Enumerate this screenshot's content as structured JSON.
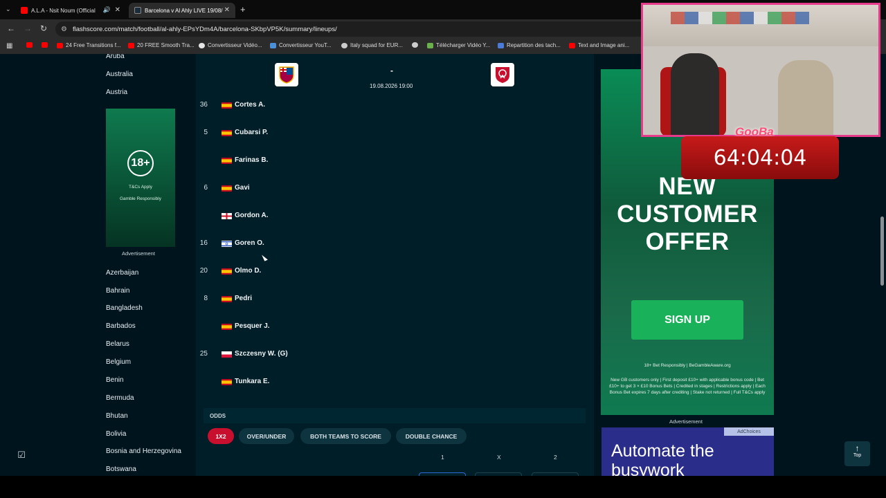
{
  "browser": {
    "tabs": [
      {
        "title": "A.L.A - Nsit Noum (Official",
        "favicon_color": "#ff0000"
      },
      {
        "title": "Barcelona v Al Ahly LIVE 19/08/",
        "favicon_color": "#1b2d3a"
      }
    ],
    "url": "flashscore.com/match/football/al-ahly-EPsYDm4A/barcelona-SKbpVP5K/summary/lineups/",
    "bookmarks": [
      {
        "label": "",
        "color": "#ff0000"
      },
      {
        "label": "",
        "color": "#ff0000"
      },
      {
        "label": "24 Free Transitions f...",
        "color": "#ff0000"
      },
      {
        "label": "20 FREE Smooth Tra...",
        "color": "#ff0000"
      },
      {
        "label": "Convertisseur Vidéo...",
        "color": "#e6e6e6"
      },
      {
        "label": "Convertisseur YouT...",
        "color": "#4a90d9"
      },
      {
        "label": "Italy squad for EUR...",
        "color": "#cccccc"
      },
      {
        "label": "",
        "color": "#cccccc"
      },
      {
        "label": "Télécharger Vidéo Y...",
        "color": "#6ab04c"
      },
      {
        "label": "Repartition des tach...",
        "color": "#4a7bd9"
      },
      {
        "label": "Text and Image ani...",
        "color": "#ff0000"
      }
    ]
  },
  "sidebar": {
    "countries_top": [
      "Aruba",
      "Australia",
      "Austria"
    ],
    "countries_bottom": [
      "Azerbaijan",
      "Bahrain",
      "Bangladesh",
      "Barbados",
      "Belarus",
      "Belgium",
      "Benin",
      "Bermuda",
      "Bhutan",
      "Bolivia",
      "Bosnia and Herzegovina",
      "Botswana"
    ],
    "ad": {
      "age": "18+",
      "tc": "T&Cs Apply",
      "gamble": "Gamble Responsibly",
      "label": "Advertisement"
    }
  },
  "match": {
    "score": "-",
    "date": "19.08.2026 19:00",
    "players": [
      {
        "num": "36",
        "name": "Cortes A.",
        "flag": "es"
      },
      {
        "num": "5",
        "name": "Cubarsi P.",
        "flag": "es"
      },
      {
        "num": "",
        "name": "Farinas B.",
        "flag": "es"
      },
      {
        "num": "6",
        "name": "Gavi",
        "flag": "es"
      },
      {
        "num": "",
        "name": "Gordon A.",
        "flag": "en"
      },
      {
        "num": "16",
        "name": "Goren O.",
        "flag": "il"
      },
      {
        "num": "20",
        "name": "Olmo D.",
        "flag": "es"
      },
      {
        "num": "8",
        "name": "Pedri",
        "flag": "es"
      },
      {
        "num": "",
        "name": "Pesquer J.",
        "flag": "es"
      },
      {
        "num": "25",
        "name": "Szczesny W. (G)",
        "flag": "pl"
      },
      {
        "num": "",
        "name": "Tunkara E.",
        "flag": "es"
      }
    ],
    "odds": {
      "title": "ODDS",
      "tabs": [
        "1X2",
        "OVER/UNDER",
        "BOTH TEAMS TO SCORE",
        "DOUBLE CHANCE"
      ],
      "columns": [
        "1",
        "X",
        "2"
      ]
    }
  },
  "right_ad": {
    "headline": [
      "NEW",
      "CUSTOMER",
      "OFFER"
    ],
    "button": "SIGN UP",
    "responsible": "18+ Bet Responsibly | BeGambleAware.org",
    "terms": "New GB customers only | First deposit £10+ with applicable bonus code | Bet £10+ to get 3 × £10 Bonus Bets | Credited in stages | Restrictions apply | Each Bonus Bet expires 7 days after crediting | Stake not returned | Full T&Cs apply",
    "label": "Advertisement"
  },
  "busy_ad": {
    "adchoices": "AdChoices",
    "line1": "Automate the",
    "line2": "busywork"
  },
  "top_button": "Top",
  "stream": {
    "name": "GooBa",
    "timer": "64:04:04"
  }
}
